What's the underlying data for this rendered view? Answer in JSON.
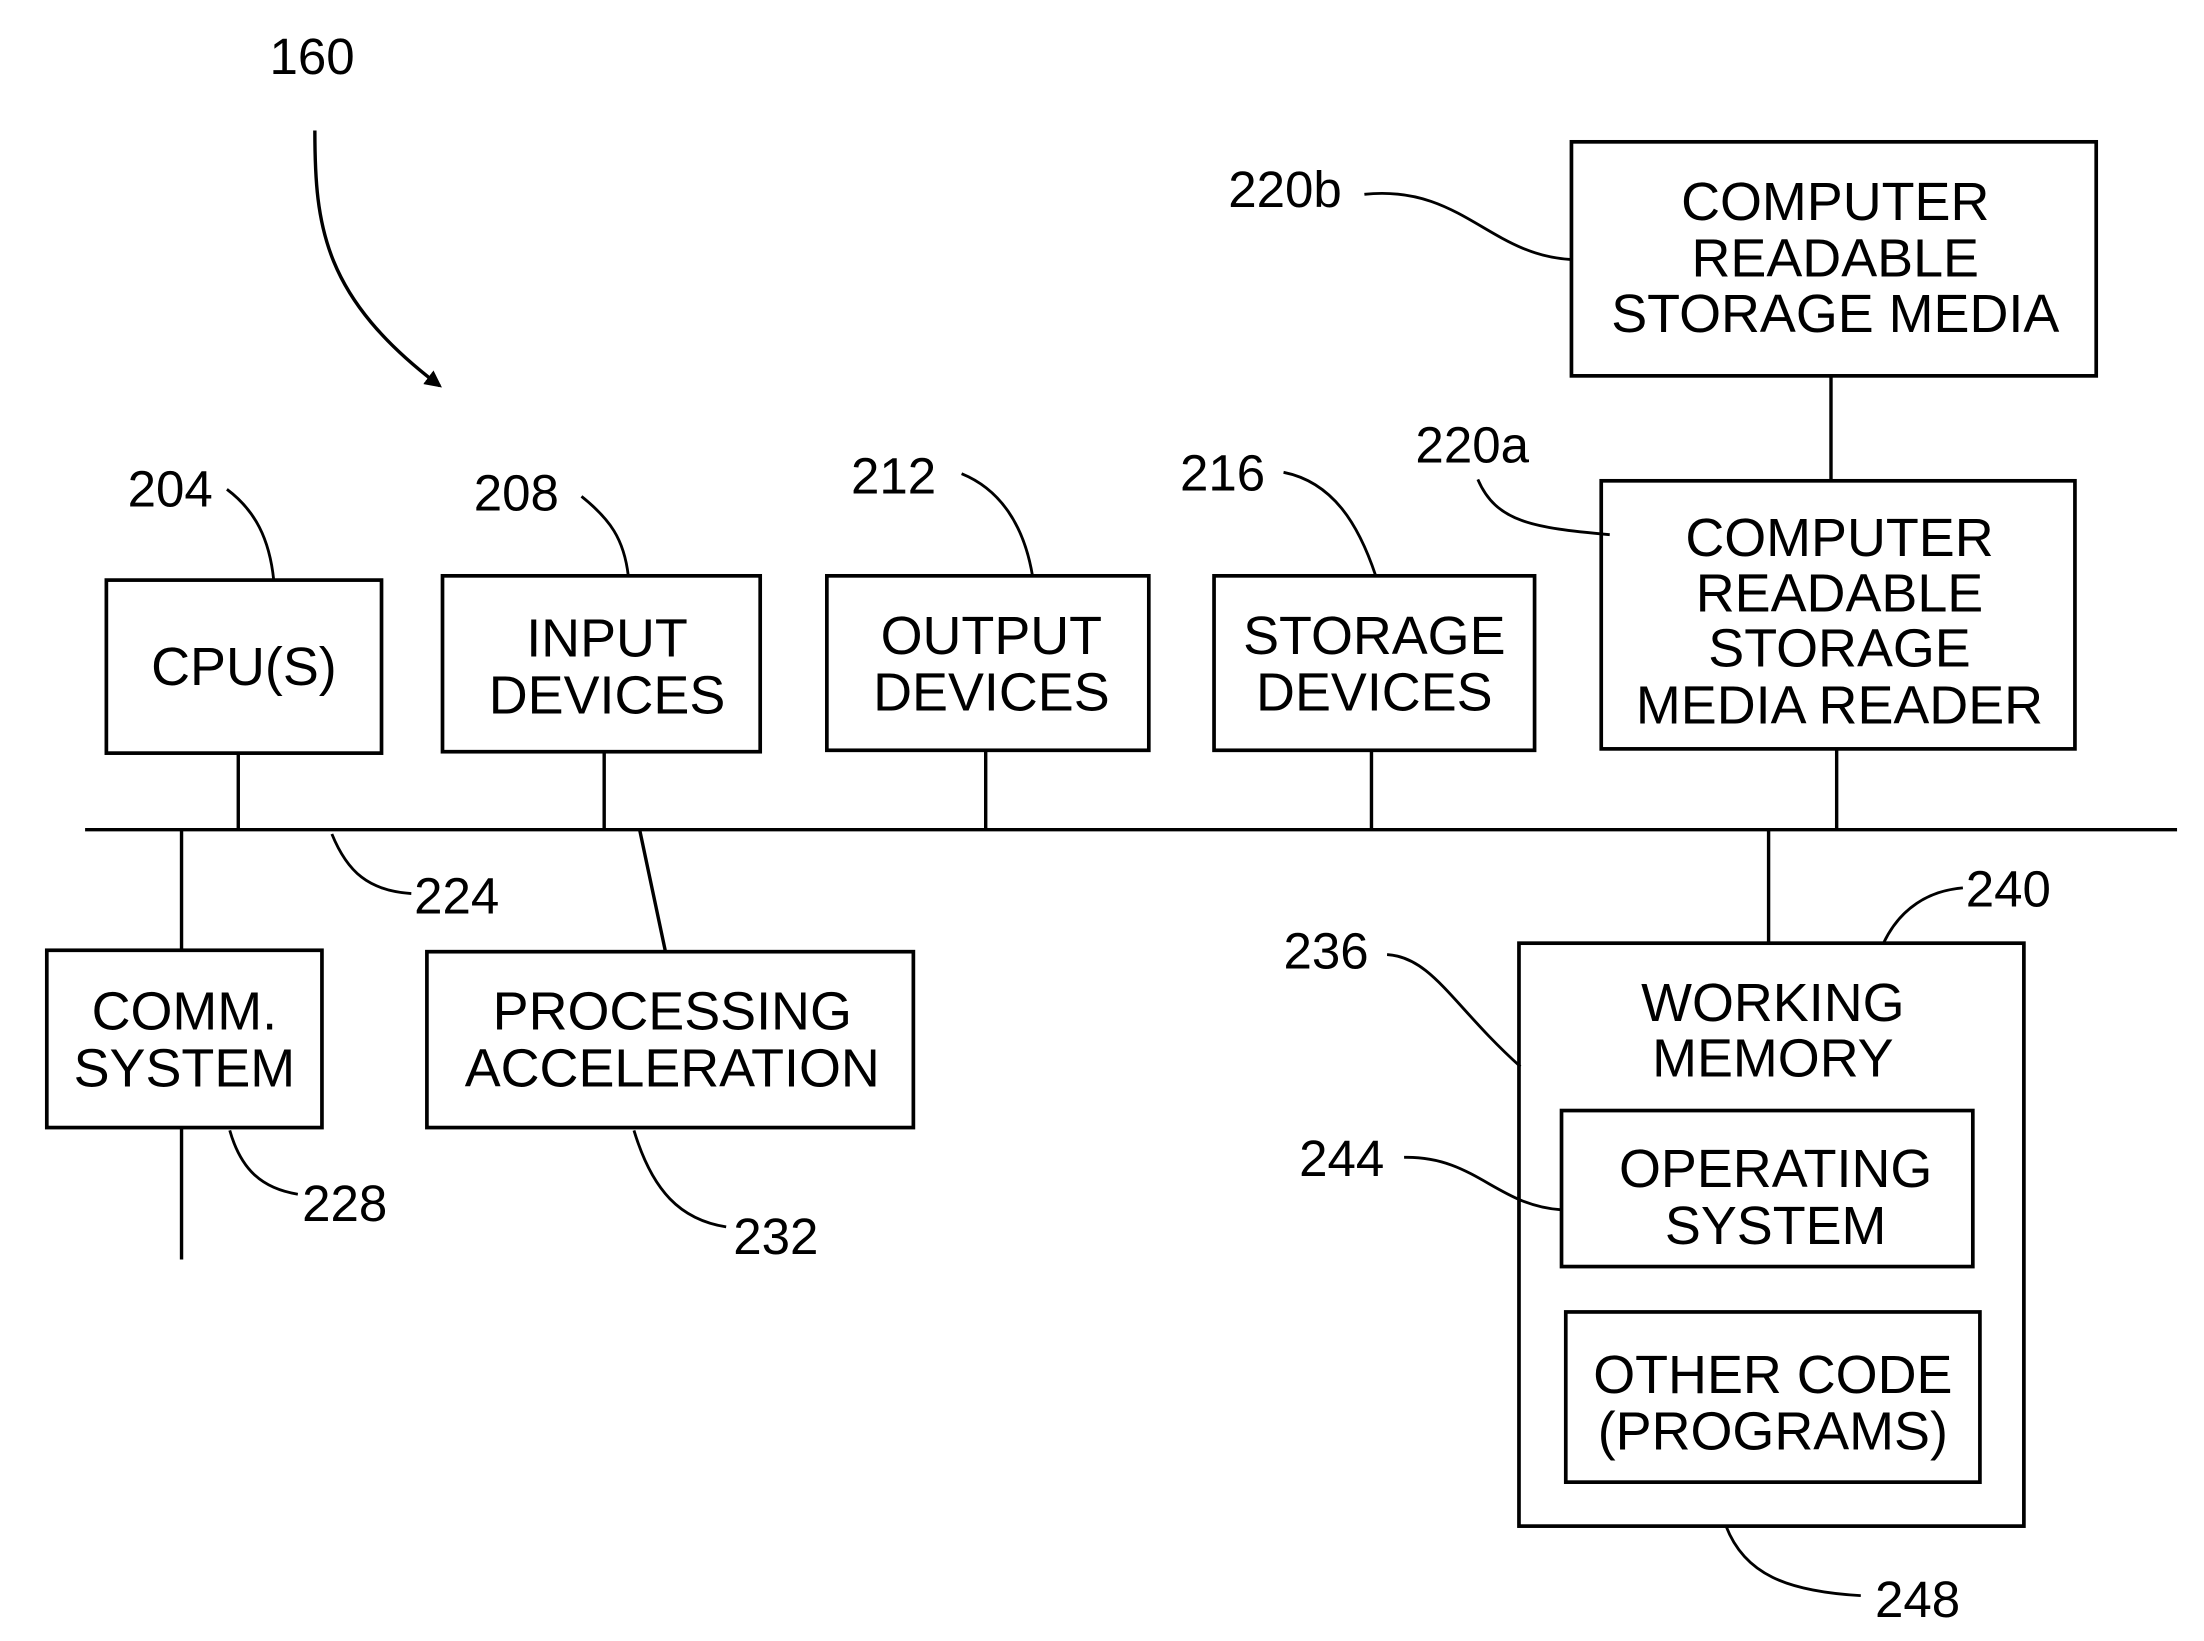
{
  "figure": {
    "ref": "160",
    "bus_ref": "224",
    "blocks": {
      "cpu": {
        "ref": "204",
        "lines": [
          "CPU(S)"
        ]
      },
      "input": {
        "ref": "208",
        "lines": [
          "INPUT",
          "DEVICES"
        ]
      },
      "output": {
        "ref": "212",
        "lines": [
          "OUTPUT",
          "DEVICES"
        ]
      },
      "storage": {
        "ref": "216",
        "lines": [
          "STORAGE",
          "DEVICES"
        ]
      },
      "media_reader": {
        "ref": "220a",
        "lines": [
          "COMPUTER",
          "READABLE",
          "STORAGE",
          "MEDIA READER"
        ]
      },
      "media": {
        "ref": "220b",
        "lines": [
          "COMPUTER",
          "READABLE",
          "STORAGE MEDIA"
        ]
      },
      "comm": {
        "ref": "228",
        "lines": [
          "COMM.",
          "SYSTEM"
        ]
      },
      "accel": {
        "ref": "232",
        "lines": [
          "PROCESSING",
          "ACCELERATION"
        ]
      },
      "working_memory": {
        "ref": "240",
        "ref_left": "236",
        "ref_bottom": "248",
        "lines": [
          "WORKING",
          "MEMORY"
        ]
      },
      "os": {
        "ref": "244",
        "lines": [
          "OPERATING",
          "SYSTEM"
        ]
      },
      "other_code": {
        "lines": [
          "OTHER CODE",
          "(PROGRAMS)"
        ]
      }
    }
  }
}
